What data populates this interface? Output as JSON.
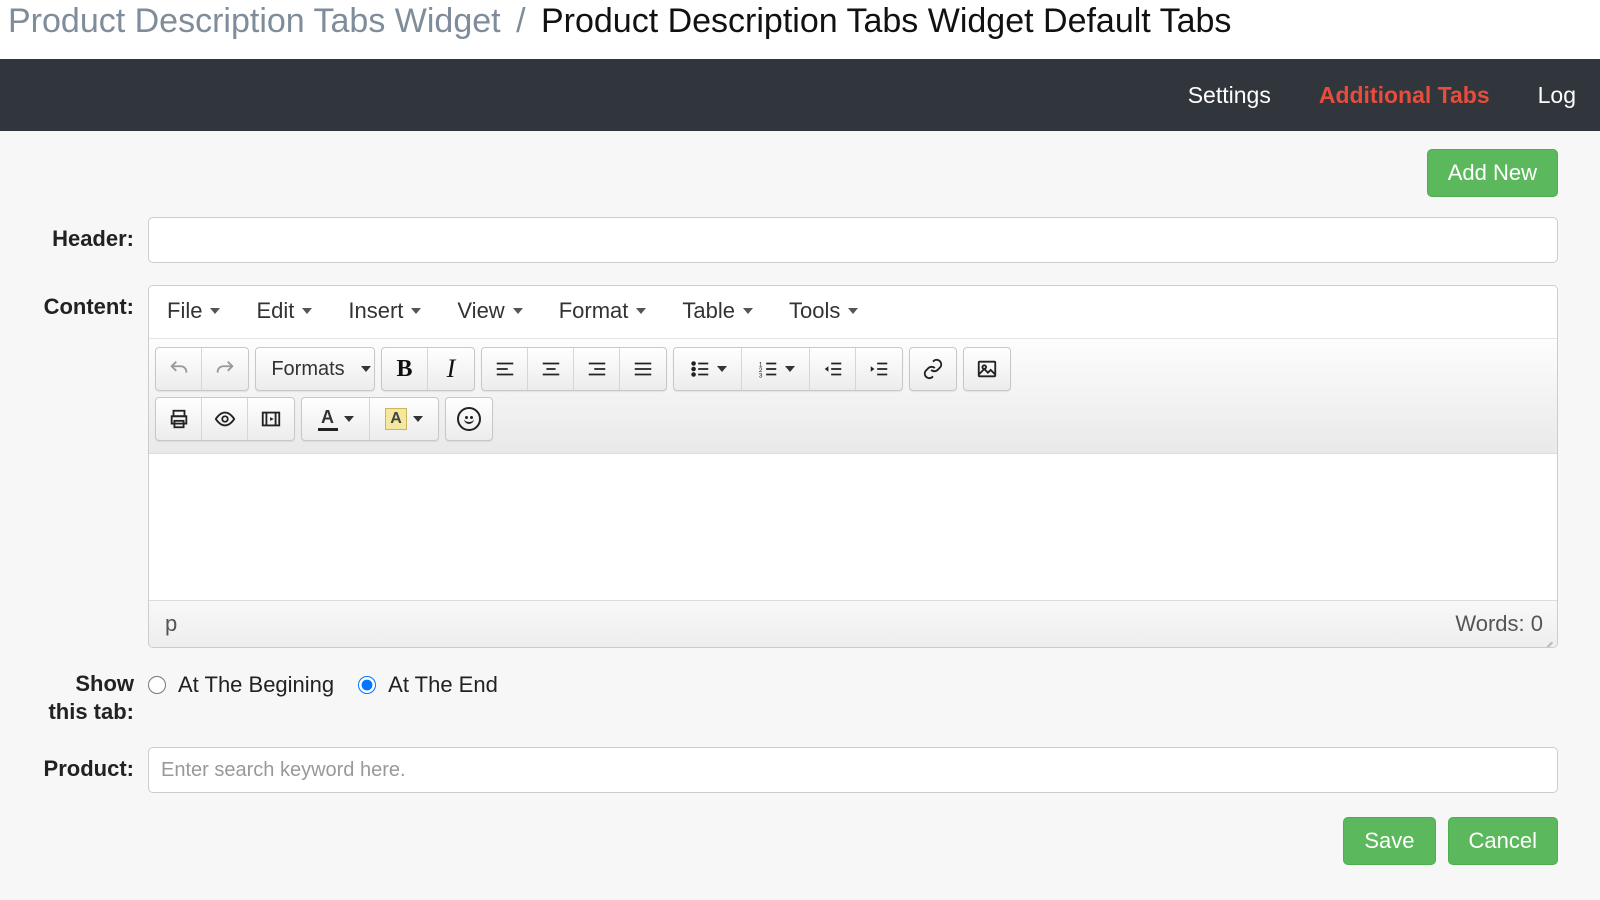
{
  "breadcrumb": {
    "parent": "Product Description Tabs Widget",
    "current": "Product Description Tabs Widget Default Tabs"
  },
  "nav": {
    "settings": "Settings",
    "additional_tabs": "Additional Tabs",
    "log": "Log"
  },
  "buttons": {
    "add_new": "Add New",
    "save": "Save",
    "cancel": "Cancel"
  },
  "labels": {
    "header": "Header:",
    "content": "Content:",
    "show_tab": "Show this tab:",
    "product": "Product:"
  },
  "editor": {
    "menus": {
      "file": "File",
      "edit": "Edit",
      "insert": "Insert",
      "view": "View",
      "format": "Format",
      "table": "Table",
      "tools": "Tools"
    },
    "formats_label": "Formats",
    "status_path": "p",
    "word_count": "Words: 0"
  },
  "radios": {
    "begin": "At The Begining",
    "end": "At The End",
    "selected": "end"
  },
  "product_placeholder": "Enter search keyword here.",
  "header_value": ""
}
